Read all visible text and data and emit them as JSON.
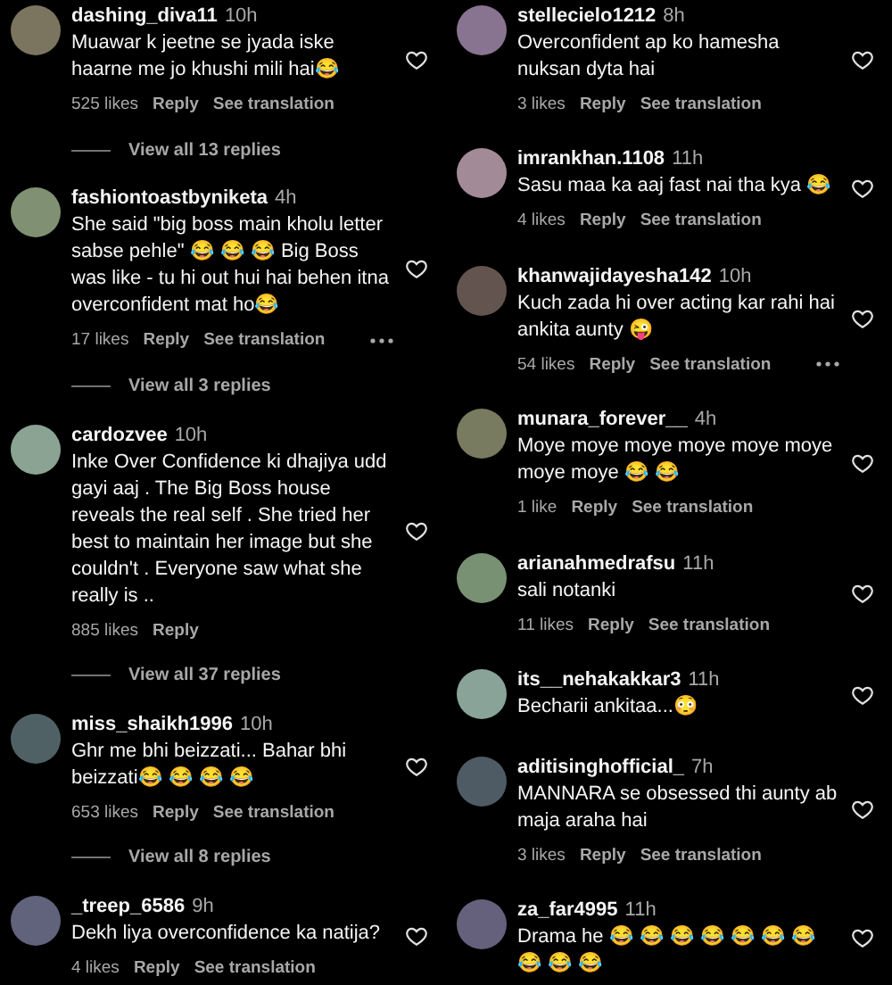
{
  "columns": [
    {
      "comments": [
        {
          "user": "dashing_diva11",
          "time": "10h",
          "text": "Muawar k jeetne se jyada iske haarne me jo khushi mili hai😂",
          "likes": "525 likes",
          "reply": "Reply",
          "translation": "See translation",
          "more_options": false,
          "view_replies": "View all 13 replies"
        },
        {
          "user": "fashiontoastbyniketa",
          "time": "4h",
          "text": "She said \"big boss main kholu letter sabse pehle\" 😂 😂 😂  Big Boss was like - tu hi out hui hai behen itna overconfident mat ho😂",
          "likes": "17 likes",
          "reply": "Reply",
          "translation": "See translation",
          "more_options": true,
          "view_replies": "View all 3 replies"
        },
        {
          "user": "cardozvee",
          "time": "10h",
          "text": "Inke Over Confidence ki dhajiya udd gayi aaj . The Big Boss house reveals the real self . She tried her best to maintain her image but she couldn't . Everyone saw what she really is ..",
          "likes": "885 likes",
          "reply": "Reply",
          "more_options": false,
          "view_replies": "View all 37 replies"
        },
        {
          "user": "miss_shaikh1996",
          "time": "10h",
          "text": "Ghr me bhi beizzati... Bahar bhi beizzati😂 😂 😂 😂",
          "likes": "653 likes",
          "reply": "Reply",
          "translation": "See translation",
          "more_options": false,
          "view_replies": "View all 8 replies"
        },
        {
          "user": "_treep_6586",
          "time": "9h",
          "text": "Dekh liya overconfidence ka natija?",
          "likes": "4 likes",
          "reply": "Reply",
          "translation": "See translation",
          "more_options": false
        }
      ]
    },
    {
      "comments": [
        {
          "user": "stellecielo1212",
          "time": "8h",
          "text": "Overconfident ap ko hamesha nuksan dyta hai",
          "likes": "3 likes",
          "reply": "Reply",
          "translation": "See translation",
          "more_options": false
        },
        {
          "user": "imrankhan.1108",
          "time": "11h",
          "text": "Sasu maa ka aaj fast nai tha kya 😂",
          "likes": "4 likes",
          "reply": "Reply",
          "translation": "See translation",
          "more_options": false
        },
        {
          "user": "khanwajidayesha142",
          "time": "10h",
          "text": "Kuch zada hi over acting kar rahi hai ankita aunty 😜",
          "likes": "54 likes",
          "reply": "Reply",
          "translation": "See translation",
          "more_options": true
        },
        {
          "user": "munara_forever__",
          "time": "4h",
          "text": "Moye moye moye moye moye moye moye moye 😂 😂",
          "likes": "1 like",
          "reply": "Reply",
          "translation": "See translation",
          "more_options": false
        },
        {
          "user": "arianahmedrafsu",
          "time": "11h",
          "text": "sali notanki",
          "likes": "11 likes",
          "reply": "Reply",
          "translation": "See translation",
          "more_options": false
        },
        {
          "user": "its__nehakakkar3",
          "time": "11h",
          "text": "Becharii ankitaa...😳",
          "more_options": false
        },
        {
          "user": "aditisinghofficial_",
          "time": "7h",
          "text": "MANNARA se obsessed thi aunty ab maja araha hai",
          "likes": "3 likes",
          "reply": "Reply",
          "translation": "See translation",
          "more_options": false
        },
        {
          "user": "za_far4995",
          "time": "11h",
          "text": "Drama he 😂 😂 😂 😂 😂 😂 😂 😂 😂 😂",
          "more_options": false
        }
      ]
    }
  ]
}
